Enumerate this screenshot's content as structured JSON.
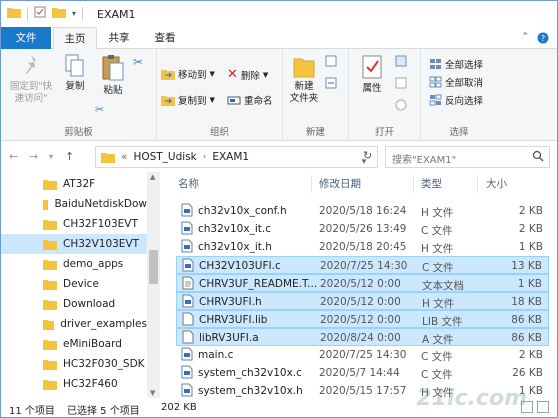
{
  "window": {
    "title": "EXAM1"
  },
  "ribbon_tabs": {
    "file": "文件",
    "home": "主页",
    "share": "共享",
    "view": "查看"
  },
  "clipboard": {
    "pin_label_1": "固定到\"快",
    "pin_label_2": "速访问\"",
    "copy": "复制",
    "paste": "粘贴",
    "group": "剪贴板"
  },
  "organize": {
    "move_to": "移动到",
    "copy_to": "复制到",
    "delete": "删除",
    "rename": "重命名",
    "group": "组织"
  },
  "new": {
    "new_folder_1": "新建",
    "new_folder_2": "文件夹",
    "group": "新建"
  },
  "open": {
    "properties": "属性",
    "group": "打开"
  },
  "select": {
    "select_all": "全部选择",
    "select_none": "全部取消",
    "invert": "反向选择",
    "group": "选择"
  },
  "address": {
    "prefix": "«",
    "crumbs": [
      "HOST_Udisk",
      "EXAM1"
    ],
    "search_placeholder": "搜索\"EXAM1\""
  },
  "nav_items": [
    {
      "label": "AT32F"
    },
    {
      "label": "BaiduNetdiskDow"
    },
    {
      "label": "CH32F103EVT"
    },
    {
      "label": "CH32V103EVT"
    },
    {
      "label": "demo_apps"
    },
    {
      "label": "Device"
    },
    {
      "label": "Download"
    },
    {
      "label": "driver_examples"
    },
    {
      "label": "eMiniBoard"
    },
    {
      "label": "HC32F030_SDK"
    },
    {
      "label": "HC32F460"
    }
  ],
  "columns": {
    "name": "名称",
    "date": "修改日期",
    "type": "类型",
    "size": "大小"
  },
  "files": [
    {
      "name": "ch32v10x_conf.h",
      "date": "2020/5/18 16:24",
      "type": "H 文件",
      "size": "2 KB",
      "selected": false
    },
    {
      "name": "ch32v10x_it.c",
      "date": "2020/5/26 13:49",
      "type": "C 文件",
      "size": "2 KB",
      "selected": false
    },
    {
      "name": "ch32v10x_it.h",
      "date": "2020/5/18 20:45",
      "type": "H 文件",
      "size": "1 KB",
      "selected": false
    },
    {
      "name": "CH32V103UFI.c",
      "date": "2020/7/25 14:30",
      "type": "C 文件",
      "size": "13 KB",
      "selected": true
    },
    {
      "name": "CHRV3UF_README.T...",
      "date": "2020/5/12 0:00",
      "type": "文本文档",
      "size": "1 KB",
      "selected": true
    },
    {
      "name": "CHRV3UFI.h",
      "date": "2020/5/12 0:00",
      "type": "H 文件",
      "size": "18 KB",
      "selected": true
    },
    {
      "name": "CHRV3UFI.lib",
      "date": "2020/5/12 0:00",
      "type": "LIB 文件",
      "size": "86 KB",
      "selected": true
    },
    {
      "name": "libRV3UFI.a",
      "date": "2020/8/24 0:00",
      "type": "A 文件",
      "size": "86 KB",
      "selected": true
    },
    {
      "name": "main.c",
      "date": "2020/7/25 14:30",
      "type": "C 文件",
      "size": "2 KB",
      "selected": false
    },
    {
      "name": "system_ch32v10x.c",
      "date": "2020/5/7 14:44",
      "type": "C 文件",
      "size": "26 KB",
      "selected": false
    },
    {
      "name": "system_ch32v10x.h",
      "date": "2020/5/15 17:57",
      "type": "H 文件",
      "size": "1 KB",
      "selected": false
    }
  ],
  "status": {
    "count": "11 个项目",
    "selected": "已选择 5 个项目",
    "size": "202 KB"
  },
  "watermark": "21ic.com"
}
